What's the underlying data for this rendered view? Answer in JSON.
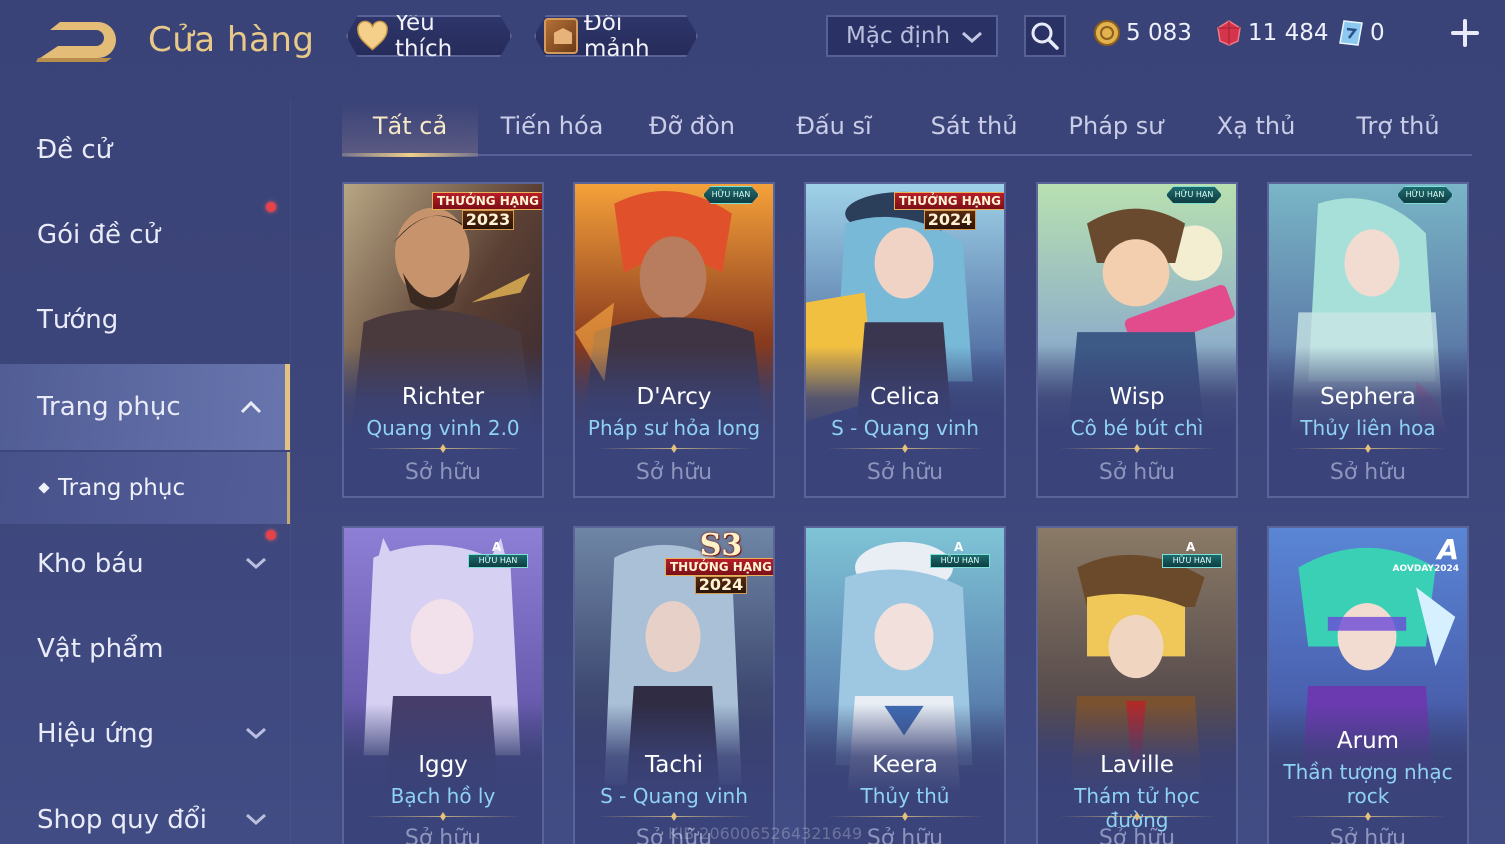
{
  "header": {
    "title": "Cửa hàng",
    "favorite_label": "Yêu thích",
    "shard_label": "Đổi mảnh",
    "sort_value": "Mặc định",
    "currency": {
      "gold": "5 083",
      "ruby": "11 484",
      "voucher": "0"
    }
  },
  "sidebar": {
    "items": [
      {
        "label": "Đề cử"
      },
      {
        "label": "Gói đề cử"
      },
      {
        "label": "Tướng"
      },
      {
        "label": "Trang phục"
      },
      {
        "label": "Kho báu"
      },
      {
        "label": "Vật phẩm"
      },
      {
        "label": "Hiệu ứng"
      },
      {
        "label": "Shop quy đổi"
      }
    ],
    "sub_item": "Trang phục"
  },
  "tabs": [
    "Tất cả",
    "Tiến hóa",
    "Đỡ đòn",
    "Đấu sĩ",
    "Sát thủ",
    "Pháp sư",
    "Xạ thủ",
    "Trợ thủ"
  ],
  "badges": {
    "rank_text": "THƯỞNG HẠNG",
    "year_2023": "2023",
    "year_2024": "2024",
    "s3": "S3",
    "limited": "HỮU HẠN",
    "a_letter": "A",
    "aov_day": "AOVDAY2024"
  },
  "cards": [
    {
      "name": "Richter",
      "skin": "Quang vinh 2.0",
      "status": "Sở hữu"
    },
    {
      "name": "D'Arcy",
      "skin": "Pháp sư hỏa long",
      "status": "Sở hữu"
    },
    {
      "name": "Celica",
      "skin": "S - Quang vinh",
      "status": "Sở hữu"
    },
    {
      "name": "Wisp",
      "skin": "Cô bé bút chì",
      "status": "Sở hữu"
    },
    {
      "name": "Sephera",
      "skin": "Thủy liên hoa",
      "status": "Sở hữu"
    },
    {
      "name": "Iggy",
      "skin": "Bạch hồ ly",
      "status": "Sở hữu"
    },
    {
      "name": "Tachi",
      "skin": "S - Quang vinh",
      "status": "Sở hữu"
    },
    {
      "name": "Keera",
      "skin": "Thủy thủ",
      "status": "Sở hữu"
    },
    {
      "name": "Laville",
      "skin": "Thám tử học đường",
      "status": "Sở hữu"
    },
    {
      "name": "Arum",
      "skin": "Thần tượng nhạc rock",
      "status": "Sở hữu"
    }
  ],
  "watermark": "KIB 2060065264321649",
  "colors": {
    "accent_gold": "#e8c98a",
    "skin_name_blue": "#8fd2f2",
    "background": "#3c4579",
    "notification_red": "#e6424a"
  }
}
